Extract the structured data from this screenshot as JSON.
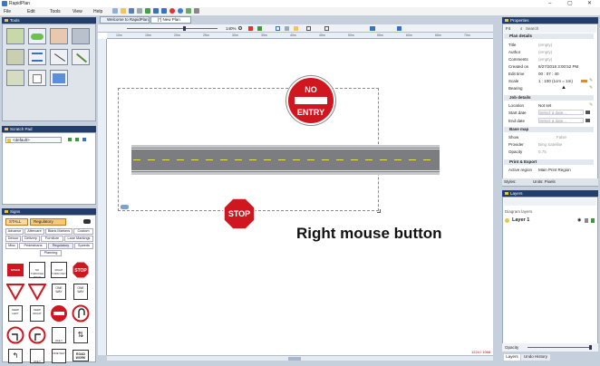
{
  "app": {
    "title": "RapidPlan"
  },
  "menu": [
    "File",
    "Edit",
    "Tools",
    "View",
    "Help"
  ],
  "tabs": [
    {
      "label": "Welcome to RapidPlan"
    },
    {
      "label": "[*] New Plan"
    }
  ],
  "zoom": "140%",
  "ruler_ticks": [
    "10m",
    "15m",
    "20m",
    "25m",
    "30m",
    "35m",
    "40m",
    "45m",
    "50m",
    "55m",
    "60m",
    "65m",
    "70m"
  ],
  "panels": {
    "tools": "Tools",
    "scratch": "Scratch Pad",
    "scratch_item": "<default>",
    "signs": "Signs",
    "layers": "Layers",
    "properties": "Properties"
  },
  "signs": {
    "path1": "STALL",
    "path2": "Regulatory",
    "filters": [
      "Advance",
      "Aftercare",
      "Blank Markers",
      "Custom",
      "Detour",
      "Delivery",
      "Furniture",
      "Lane Markings",
      "Misc",
      "Pedestrians",
      "Regulatory",
      "Speeds",
      "Planning"
    ]
  },
  "properties": {
    "search_placeholder": "Search",
    "plan_details": "Plan details",
    "rows": [
      {
        "k": "Title",
        "v": "(empty)",
        "gray": true
      },
      {
        "k": "Author",
        "v": "(empty)",
        "gray": true
      },
      {
        "k": "Comments",
        "v": "(empty)",
        "gray": true
      },
      {
        "k": "Created on",
        "v": "8/27/2018 3:00:52 PM",
        "gray": false
      },
      {
        "k": "Edit time",
        "v": "00 : 07 : 40",
        "gray": false
      },
      {
        "k": "Scale",
        "v": "1 : 100   (1cm = 1m)",
        "gray": false
      },
      {
        "k": "Bearing",
        "v": "",
        "gray": false
      }
    ],
    "job_details": "Job details",
    "job_rows": [
      {
        "k": "Location",
        "v": "Not set",
        "gray": false
      },
      {
        "k": "Start date",
        "v": "Select a date...",
        "gray": true
      },
      {
        "k": "End date",
        "v": "Select a date...",
        "gray": true
      }
    ],
    "base_map": "Base map",
    "map_rows": [
      {
        "k": "Show",
        "v": "False",
        "gray": true
      },
      {
        "k": "Provider",
        "v": "Bing Satellite",
        "gray": true
      },
      {
        "k": "Opacity",
        "v": "0.75",
        "gray": true
      }
    ],
    "print_export": "Print & Export",
    "print_rows": [
      {
        "k": "Active region",
        "v": "Main Print Region",
        "gray": false
      }
    ],
    "styles_label": "Styles:",
    "units_label": "Units: Pixels"
  },
  "layers": {
    "header": "Diagram layers",
    "layer1": "Layer 1"
  },
  "canvas": {
    "no_entry_top": "NO",
    "no_entry_bottom": "ENTRY",
    "stop": "STOP",
    "annotation": "Right mouse button",
    "coords": "1224 / 1068"
  },
  "palette_texts": {
    "s1": "SPEED LIMIT",
    "s2": "NO THROUGH ROAD",
    "s3": "RIGHT TURN ONLY",
    "stop": "STOP",
    "one_way": "ONE WAY",
    "keep_left": "KEEP LEFT",
    "keep_right": "KEEP RIGHT",
    "only": "ONLY",
    "road_work": "ROAD WORK"
  },
  "bottom": {
    "opacity_label": "Opacity",
    "tab_layers": "Layers",
    "tab_undo": "Undo History"
  },
  "colors": {
    "header": "#233e6b",
    "red": "#d0161f",
    "accent": "#f4c430"
  }
}
